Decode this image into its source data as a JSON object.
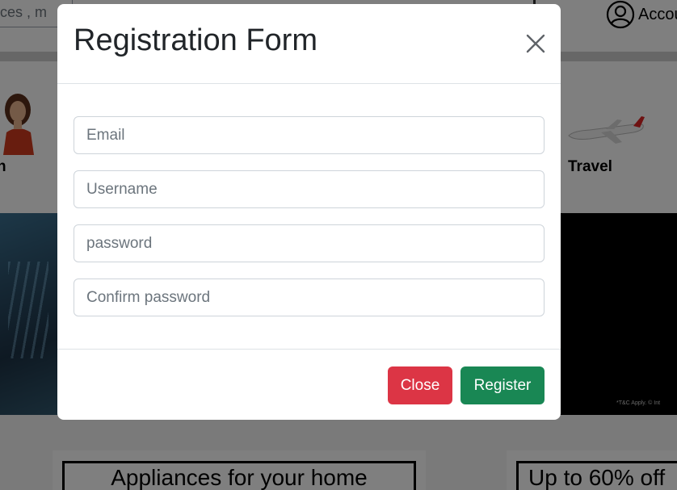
{
  "background": {
    "search": {
      "visible_text": "ces  ,  m"
    },
    "account": {
      "label": "Accou",
      "icon": "user-circle-icon"
    },
    "categories": [
      {
        "label": "n",
        "icon": "fashion-model-image"
      },
      {
        "label": "Travel",
        "icon": "airplane-image"
      }
    ],
    "banner_right": {
      "fine_print": "*T&C Apply. © Int"
    },
    "promo_cards": [
      {
        "title": "Appliances for your home"
      },
      {
        "title": "Up to 60% off"
      }
    ]
  },
  "modal": {
    "title": "Registration Form",
    "close_icon": "close-icon",
    "fields": {
      "email": {
        "placeholder": "Email",
        "value": ""
      },
      "username": {
        "placeholder": "Username",
        "value": ""
      },
      "password": {
        "placeholder": "password",
        "value": ""
      },
      "confirm_password": {
        "placeholder": "Confirm password",
        "value": ""
      }
    },
    "buttons": {
      "close_label": "Close",
      "register_label": "Register"
    }
  },
  "colors": {
    "close_button": "#dc3545",
    "register_button": "#198754",
    "backdrop": "rgba(0,0,0,0.5)"
  }
}
